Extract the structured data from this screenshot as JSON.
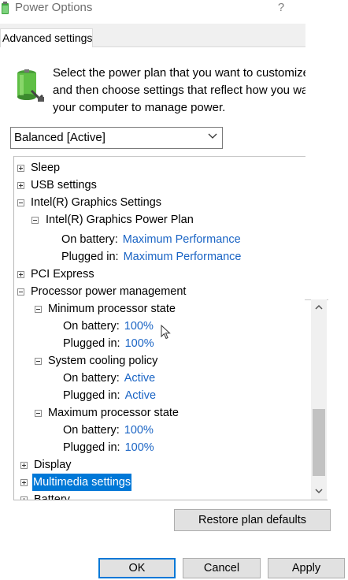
{
  "window": {
    "title": "Power Options",
    "help": "?"
  },
  "tab": {
    "label": "Advanced settings"
  },
  "description": {
    "line1": "Select the power plan that you want to customize,",
    "line2": "and then choose settings that reflect how you want",
    "line3": "your computer to manage power."
  },
  "plan_select": {
    "value": "Balanced [Active]"
  },
  "tree": {
    "sleep": "Sleep",
    "usb": "USB settings",
    "intel": "Intel(R) Graphics Settings",
    "intel_plan": "Intel(R) Graphics Power Plan",
    "intel_on_battery_label": "On battery:",
    "intel_on_battery_value": "Maximum Performance",
    "intel_plugged_label": "Plugged in:",
    "intel_plugged_value": "Maximum Performance",
    "pci": "PCI Express",
    "ppm": "Processor power management",
    "min_state": "Minimum processor state",
    "min_on_battery_label": "On battery:",
    "min_on_battery_value": "100%",
    "min_plugged_label": "Plugged in:",
    "min_plugged_value": "100%",
    "cooling": "System cooling policy",
    "cool_on_battery_label": "On battery:",
    "cool_on_battery_value": "Active",
    "cool_plugged_label": "Plugged in:",
    "cool_plugged_value": "Active",
    "max_state": "Maximum processor state",
    "max_on_battery_label": "On battery:",
    "max_on_battery_value": "100%",
    "max_plugged_label": "Plugged in:",
    "max_plugged_value": "100%",
    "display": "Display",
    "multimedia": "Multimedia settings",
    "battery": "Battery"
  },
  "buttons": {
    "restore": "Restore plan defaults",
    "ok": "OK",
    "cancel": "Cancel",
    "apply": "Apply"
  },
  "colors": {
    "accent": "#0078d7",
    "value_link": "#1a64c4"
  }
}
